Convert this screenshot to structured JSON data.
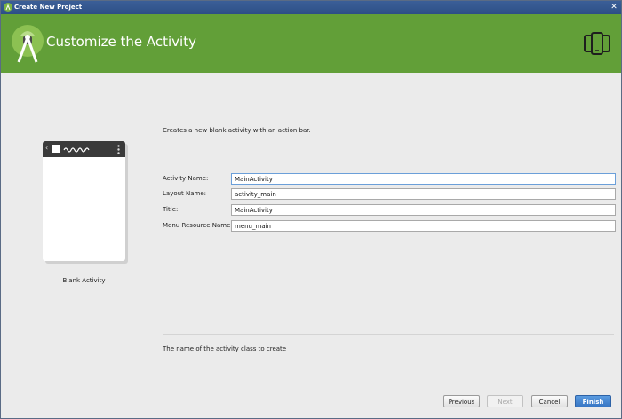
{
  "window": {
    "title": "Create New Project",
    "close_glyph": "✕"
  },
  "header": {
    "title": "Customize the Activity",
    "logo_icon": "android-studio-icon",
    "device_icon": "device-icon"
  },
  "preview": {
    "label": "Blank Activity",
    "back_glyph": "‹"
  },
  "form": {
    "description": "Creates a new blank activity with an action bar.",
    "fields": [
      {
        "label": "Activity Name:",
        "value": "MainActivity"
      },
      {
        "label": "Layout Name:",
        "value": "activity_main"
      },
      {
        "label": "Title:",
        "value": "MainActivity"
      },
      {
        "label": "Menu Resource Name:",
        "value": "menu_main"
      }
    ],
    "hint": "The name of the activity class to create"
  },
  "buttons": {
    "previous": "Previous",
    "next": "Next",
    "cancel": "Cancel",
    "finish": "Finish"
  },
  "colors": {
    "header_green": "#629f38",
    "accent_blue": "#3876c4"
  }
}
